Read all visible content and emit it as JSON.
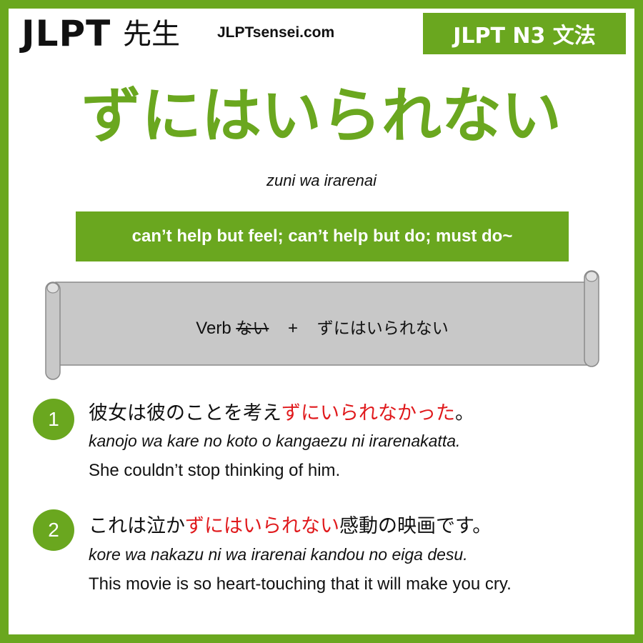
{
  "header": {
    "logo_latin": "JLPT",
    "logo_kanji": "先生",
    "site": "JLPTsensei.com",
    "level_badge": "JLPT N3 文法"
  },
  "grammar": {
    "title": "ずにはいられない",
    "romaji": "zuni wa irarenai",
    "meaning": "can’t help but feel; can’t help but do; must do~"
  },
  "formula": {
    "verb": "Verb",
    "struck": "ない",
    "plus": "+",
    "pattern": "ずにはいられない"
  },
  "examples": [
    {
      "number": "1",
      "jp_before": "彼女は彼のことを考え",
      "jp_highlight": "ずにいられなかった",
      "jp_after": "。",
      "romaji": "kanojo wa kare no koto o kangaezu ni irarenakatta.",
      "english": "She couldn’t stop thinking of him."
    },
    {
      "number": "2",
      "jp_before": "これは泣か",
      "jp_highlight": "ずにはいられない",
      "jp_after": "感動の映画です。",
      "romaji": "kore wa nakazu ni wa irarenai kandou no eiga desu.",
      "english": "This movie is so heart-touching that it will make you cry."
    }
  ],
  "colors": {
    "accent": "#6aa71f",
    "highlight": "#e0191c",
    "scroll": "#c8c8c8"
  }
}
